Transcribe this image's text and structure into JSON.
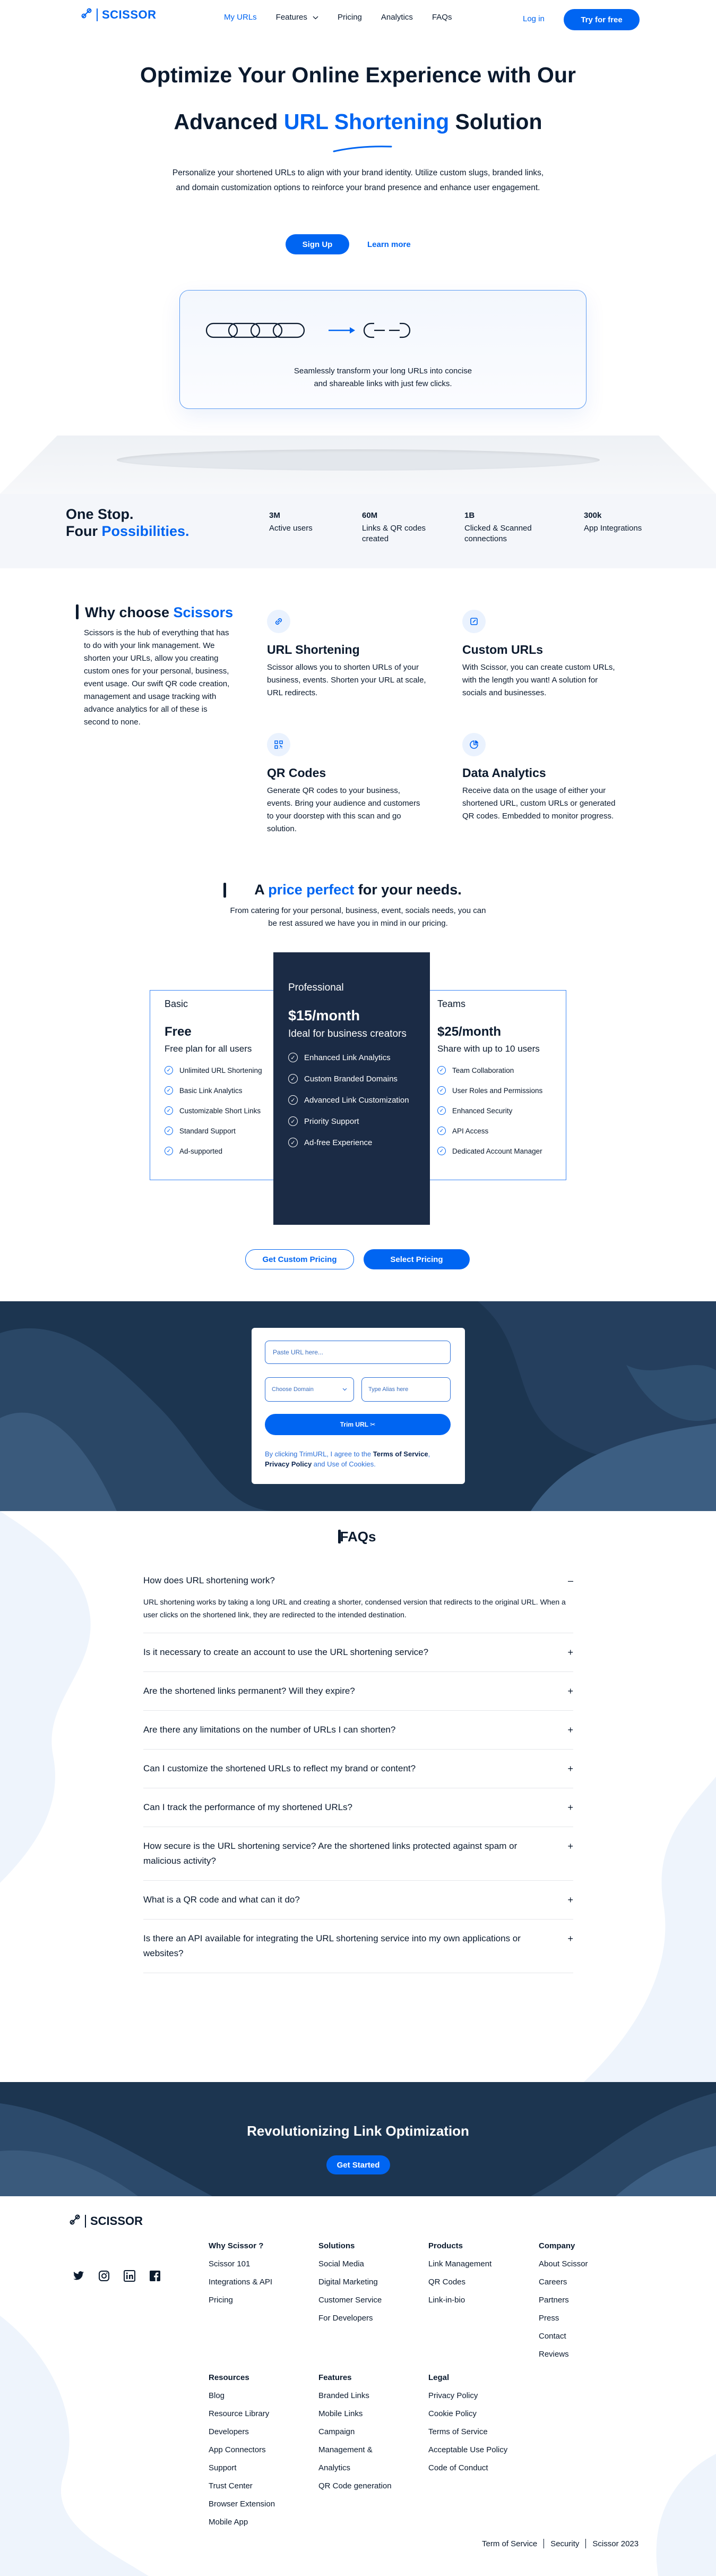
{
  "nav": {
    "logo_text": "SCISSOR",
    "links": [
      "My URLs",
      "Features",
      "Pricing",
      "Analytics",
      "FAQs"
    ],
    "login": "Log in",
    "try": "Try for free"
  },
  "hero": {
    "title_line1": "Optimize Your Online Experience with Our",
    "title_line2_pre": "Advanced ",
    "title_line2_blue": "URL Shortening",
    "title_line2_post": " Solution",
    "description": "Personalize your shortened URLs to align with your brand identity. Utilize custom slugs, branded links, and domain customization options to reinforce your brand presence and enhance user engagement.",
    "signup": "Sign Up",
    "learn_more": "Learn more",
    "card_caption_1": "Seamlessly transform your long URLs into concise",
    "card_caption_2": "and shareable links with just few clicks."
  },
  "stats": {
    "title_line1": "One Stop.",
    "title_line2_pre": "Four ",
    "title_line2_blue": "Possibilities.",
    "items": [
      {
        "num": "3M",
        "label": "Active users"
      },
      {
        "num": "60M",
        "label": "Links & QR codes created"
      },
      {
        "num": "1B",
        "label": "Clicked & Scanned connections"
      },
      {
        "num": "300k",
        "label": "App Integrations"
      }
    ]
  },
  "why": {
    "title_pre": "Why choose ",
    "title_blue": "Scissors",
    "description": "Scissors is the hub of everything that has to do with your link management. We shorten your URLs, allow you creating custom ones for your personal, business, event usage. Our swift QR code creation, management and usage tracking with advance analytics for all of these is second to none.",
    "features": [
      {
        "title": "URL Shortening",
        "text": "Scissor allows you to shorten URLs of your business, events. Shorten your URL at scale, URL redirects."
      },
      {
        "title": "Custom URLs",
        "text": "With Scissor, you can create custom URLs, with the length you want! A solution for socials and businesses."
      },
      {
        "title": "QR Codes",
        "text": "Generate QR codes to your business, events. Bring your audience and customers to your doorstep with this scan and go solution."
      },
      {
        "title": "Data Analytics",
        "text": "Receive data on the usage of either your shortened URL, custom URLs or generated QR codes. Embedded to monitor progress."
      }
    ]
  },
  "pricing": {
    "title_pre": "A ",
    "title_blue": "price perfect",
    "title_post": " for your needs.",
    "description": "From catering for your personal, business, event, socials needs, you can be rest assured we have you in mind in our pricing.",
    "plans": [
      {
        "name": "Basic",
        "price": "Free",
        "sub": "Free plan for all users",
        "features": [
          "Unlimited URL Shortening",
          "Basic Link Analytics",
          "Customizable Short Links",
          "Standard Support",
          "Ad-supported"
        ]
      },
      {
        "name": "Professional",
        "price": "$15/month",
        "sub": "Ideal for business creators",
        "features": [
          "Enhanced Link Analytics",
          "Custom Branded Domains",
          "Advanced Link Customization",
          "Priority Support",
          "Ad-free Experience"
        ]
      },
      {
        "name": "Teams",
        "price": "$25/month",
        "sub": "Share with up to 10 users",
        "features": [
          "Team Collaboration",
          "User Roles and Permissions",
          "Enhanced Security",
          "API Access",
          "Dedicated Account Manager"
        ]
      }
    ],
    "btn_custom": "Get Custom Pricing",
    "btn_select": "Select Pricing"
  },
  "shorten": {
    "url_placeholder": "Paste URL here...",
    "domain_placeholder": "Choose Domain",
    "alias_placeholder": "Type Alias here",
    "button": "Trim URL ✂",
    "note_pre": "By clicking TrimURL, I agree to the ",
    "note_terms": "Terms of Service",
    "note_mid": ", ",
    "note_privacy": "Privacy Policy",
    "note_post": " and Use of Cookies."
  },
  "faq": {
    "title": "FAQs",
    "items": [
      {
        "q": "How does URL shortening work?",
        "a": "URL shortening works by taking a long URL and creating a shorter, condensed version that redirects to the original URL. When a user clicks on the shortened link, they are redirected to the intended destination.",
        "open": true
      },
      {
        "q": "Is it necessary to create an account to use the URL shortening service?",
        "a": "",
        "open": false
      },
      {
        "q": "Are the shortened links permanent? Will they expire?",
        "a": "",
        "open": false
      },
      {
        "q": "Are there any limitations on the number of URLs I can shorten?",
        "a": "",
        "open": false
      },
      {
        "q": "Can I customize the shortened URLs to reflect my brand or content?",
        "a": "",
        "open": false
      },
      {
        "q": "Can I track the performance of my shortened URLs?",
        "a": "",
        "open": false
      },
      {
        "q": "How secure is the URL shortening service? Are the shortened links protected against spam or malicious activity?",
        "a": "",
        "open": false
      },
      {
        "q": "What is a QR code and what can it do?",
        "a": "",
        "open": false
      },
      {
        "q": "Is there an API available for integrating the URL shortening service into my own applications or websites?",
        "a": "",
        "open": false
      }
    ]
  },
  "cta": {
    "title": "Revolutionizing Link Optimization",
    "button": "Get Started"
  },
  "footer": {
    "logo_text": "SCISSOR",
    "columns": [
      {
        "title": "Why Scissor ?",
        "items": [
          "Scissor 101",
          "Integrations & API",
          "Pricing"
        ]
      },
      {
        "title": "Solutions",
        "items": [
          "Social Media",
          "Digital Marketing",
          "Customer Service",
          "For Developers"
        ]
      },
      {
        "title": "Products",
        "items": [
          "Link Management",
          "QR Codes",
          "Link-in-bio"
        ]
      },
      {
        "title": "Company",
        "items": [
          "About Scissor",
          "Careers",
          "Partners",
          "Press",
          "Contact",
          "Reviews"
        ]
      },
      {
        "title": "Resources",
        "items": [
          "Blog",
          "Resource Library",
          "Developers",
          "App Connectors",
          "Support",
          "Trust Center",
          "Browser Extension",
          "Mobile App"
        ]
      },
      {
        "title": "Features",
        "items": [
          "Branded Links",
          "Mobile Links",
          "Campaign",
          "Management &",
          "Analytics",
          "QR Code generation"
        ]
      },
      {
        "title": "Legal",
        "items": [
          "Privacy Policy",
          "Cookie Policy",
          "Terms of Service",
          "Acceptable Use Policy",
          "Code of Conduct"
        ]
      }
    ],
    "bottom": [
      "Term of Service",
      "Security",
      "Scissor 2023"
    ]
  },
  "colors": {
    "brand": "#0065f2",
    "navy": "#1b2b45",
    "band": "#1c3550"
  }
}
